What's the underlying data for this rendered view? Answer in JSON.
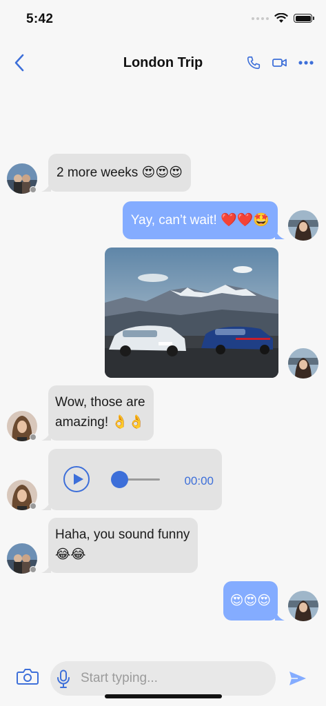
{
  "status_bar": {
    "time": "5:42"
  },
  "header": {
    "title": "London Trip",
    "back_icon": "chevron-left-icon",
    "actions": [
      "phone-icon",
      "video-icon",
      "more-icon"
    ]
  },
  "colors": {
    "accent": "#3d6fd9",
    "outgoing_bubble": "#84acff",
    "incoming_bubble": "#e3e3e3"
  },
  "messages": [
    {
      "direction": "incoming",
      "type": "text",
      "text": "2 more weeks 😍😍😍"
    },
    {
      "direction": "outgoing",
      "type": "text",
      "text": "Yay, can’t wait! ❤️❤️🤩"
    },
    {
      "direction": "outgoing",
      "type": "image",
      "image": "photo of two cars by mountains"
    },
    {
      "direction": "incoming",
      "type": "text",
      "lines": [
        "Wow, those are",
        "amazing! 👌👌"
      ]
    },
    {
      "direction": "incoming",
      "type": "audio",
      "duration": "00:00",
      "progress": 0
    },
    {
      "direction": "incoming",
      "type": "text",
      "lines": [
        "Haha, you sound funny",
        "😂😂"
      ]
    },
    {
      "direction": "outgoing",
      "type": "text",
      "text": "😍😍😍"
    }
  ],
  "composer": {
    "placeholder": "Start typing...",
    "value": ""
  }
}
